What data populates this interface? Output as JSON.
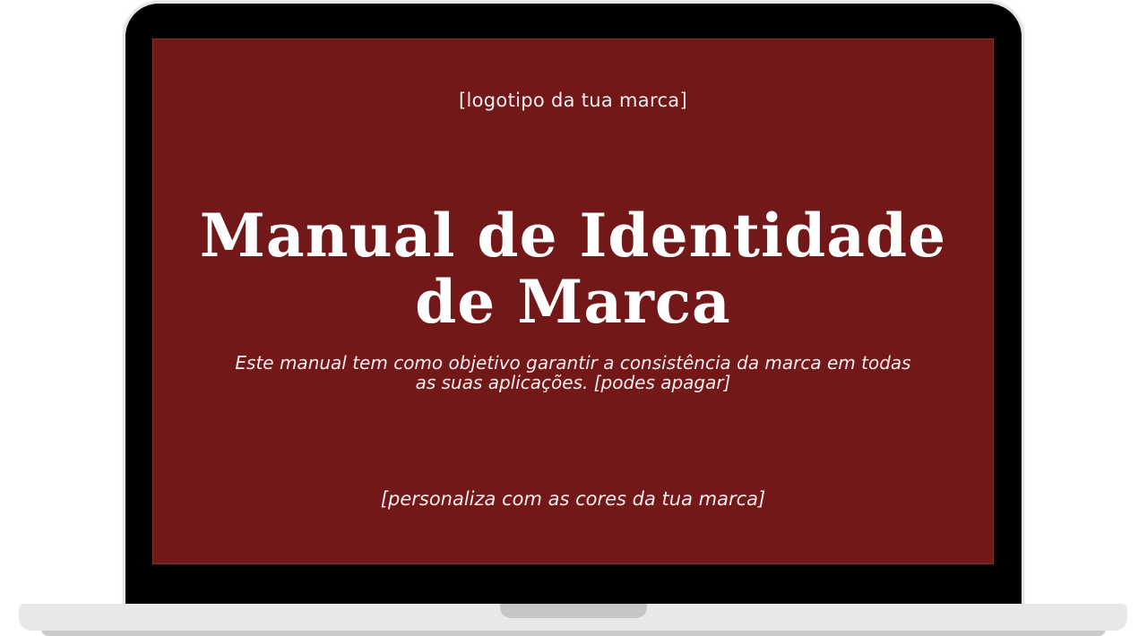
{
  "slide": {
    "logo_placeholder": "[logotipo da tua marca]",
    "title_line1": "Manual de Identidade",
    "title_line2": "de Marca",
    "subtitle_line1": "Este manual tem como objetivo garantir a consistência da marca em todas",
    "subtitle_line2": "as suas aplicações. [podes apagar]",
    "footer_note": "[personaliza com as cores da tua marca]"
  },
  "colors": {
    "screen_background": "#721818",
    "text": "#ffffff",
    "bezel": "#000000",
    "laptop_body": "#e8e8e8"
  }
}
